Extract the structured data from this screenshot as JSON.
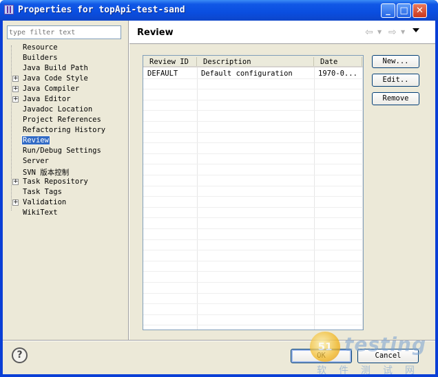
{
  "window": {
    "title": "Properties for topApi-test-sand",
    "minimize_label": "_",
    "maximize_label": "□",
    "close_label": "✕"
  },
  "filter": {
    "placeholder": "type filter text"
  },
  "tree": {
    "items": [
      {
        "label": "Resource",
        "expandable": false
      },
      {
        "label": "Builders",
        "expandable": false
      },
      {
        "label": "Java Build Path",
        "expandable": false
      },
      {
        "label": "Java Code Style",
        "expandable": true
      },
      {
        "label": "Java Compiler",
        "expandable": true
      },
      {
        "label": "Java Editor",
        "expandable": true
      },
      {
        "label": "Javadoc Location",
        "expandable": false
      },
      {
        "label": "Project References",
        "expandable": false
      },
      {
        "label": "Refactoring History",
        "expandable": false
      },
      {
        "label": "Review",
        "expandable": false,
        "selected": true
      },
      {
        "label": "Run/Debug Settings",
        "expandable": false
      },
      {
        "label": "Server",
        "expandable": false
      },
      {
        "label": "SVN 版本控制",
        "expandable": false
      },
      {
        "label": "Task Repository",
        "expandable": true
      },
      {
        "label": "Task Tags",
        "expandable": false
      },
      {
        "label": "Validation",
        "expandable": true
      },
      {
        "label": "WikiText",
        "expandable": false
      }
    ],
    "expand_glyph": "+"
  },
  "page": {
    "title": "Review",
    "back_icon": "⇦",
    "forward_icon": "⇨",
    "dropdown_glyph": "▼"
  },
  "review_table": {
    "columns": [
      "Review ID",
      "Description",
      "Date"
    ],
    "rows": [
      [
        "DEFAULT",
        "Default configuration",
        "1970-0..."
      ]
    ]
  },
  "buttons": {
    "new": "New...",
    "edit": "Edit..",
    "remove": "Remove"
  },
  "dialog": {
    "help": "?",
    "ok": "OK",
    "cancel": "Cancel"
  },
  "watermark": {
    "badge": "51",
    "brand": "testing",
    "subtitle": "软件测试网"
  }
}
